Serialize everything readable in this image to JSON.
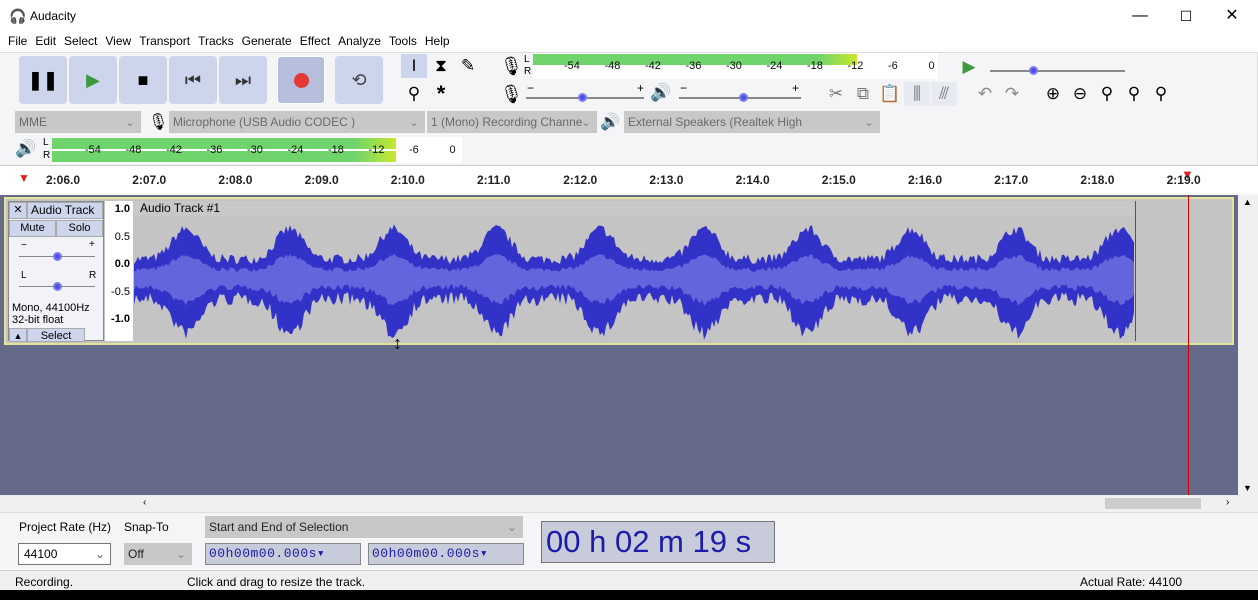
{
  "window": {
    "title": "Audacity",
    "minimize": "—",
    "maximize": "☐",
    "close": "✕"
  },
  "menu": [
    "File",
    "Edit",
    "Select",
    "View",
    "Transport",
    "Tracks",
    "Generate",
    "Effect",
    "Analyze",
    "Tools",
    "Help"
  ],
  "transport": {
    "buttons": [
      "pause",
      "play",
      "stop",
      "skip-start",
      "skip-end",
      "record",
      "loop"
    ],
    "record_color": "#e53935",
    "play_color": "#3b9a3b"
  },
  "tools": [
    "selection-tool",
    "envelope-tool",
    "draw-tool",
    "zoom-tool",
    "multi-tool"
  ],
  "meter_ticks": [
    "-54",
    "-48",
    "-42",
    "-36",
    "-30",
    "-24",
    "-18",
    "-12",
    "-6",
    "0"
  ],
  "recording_meter": {
    "L": "L",
    "R": "R",
    "level_db": -9
  },
  "playback_meter": {
    "L": "L",
    "R": "R",
    "level_db": -9
  },
  "mixer": {
    "minus": "−",
    "plus": "+",
    "recording_volume": 0.5,
    "playback_volume": 0.5
  },
  "devices": {
    "host": "MME",
    "input": "Microphone (USB Audio CODEC )",
    "channels": "1 (Mono) Recording Channe",
    "output": "External Speakers (Realtek High"
  },
  "timeline": [
    "2:06.0",
    "2:07.0",
    "2:08.0",
    "2:09.0",
    "2:10.0",
    "2:11.0",
    "2:12.0",
    "2:13.0",
    "2:14.0",
    "2:15.0",
    "2:16.0",
    "2:17.0",
    "2:18.0",
    "2:19.0"
  ],
  "track": {
    "name": "Audio Track",
    "clip_name": "Audio Track #1",
    "close": "✕",
    "mute": "Mute",
    "solo": "Solo",
    "gain_minus": "−",
    "gain_plus": "+",
    "pan_l": "L",
    "pan_r": "R",
    "info1": "Mono, 44100Hz",
    "info2": "32-bit float",
    "select": "Select",
    "scale": [
      "1.0",
      "0.5",
      "0.0",
      "-0.5",
      "-1.0"
    ],
    "wave_color": "#3232c8"
  },
  "selection_toolbar": {
    "project_rate_label": "Project Rate (Hz)",
    "snap_label": "Snap-To",
    "project_rate": "44100",
    "snap": "Off",
    "mode": "Start and End of Selection",
    "start": "00h00m00.000s",
    "end": "00h00m00.000s"
  },
  "time_display": "00 h 02 m 19 s",
  "status": {
    "state": "Recording.",
    "hint": "Click and drag to resize the track.",
    "rate": "Actual Rate: 44100"
  }
}
